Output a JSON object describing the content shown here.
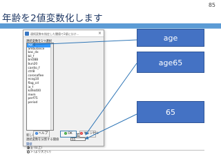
{
  "slide": {
    "number": "85",
    "title": "年齢を2値変数化します"
  },
  "dialog": {
    "title": "連続変数を指定した閾値で2値に分け...",
    "select_label": "連続変数を1つ選択",
    "variables": [
      "age",
      "ambulance",
      "bac_dx",
      "bil_f",
      "bnOBB",
      "bun20",
      "cardio_f",
      "ctrl8",
      "coronaflee",
      "ecog10",
      "flag_cd",
      "ie_f",
      "kdhk400",
      "mem",
      "perf75",
      "period"
    ],
    "selected_variable": "age",
    "new_var_label": "新しい変数名",
    "new_var_value": "age65",
    "threshold_label": "連続変数を分割する閾値",
    "threshold_value": "65",
    "direction_label": "閾値",
    "radio_options": [
      "≧ (以上)",
      "> (より大きい)"
    ],
    "radio_selected": 0,
    "buttons": {
      "help": "ヘルプ",
      "ok": "OK",
      "cancel": "キャンセル"
    }
  },
  "annotations": [
    {
      "text": "age"
    },
    {
      "text": "age65"
    },
    {
      "text": "65"
    }
  ],
  "colors": {
    "accent": "#4472c4",
    "title_text": "#1f3864",
    "title_bar": "#5b9bd5",
    "arrow": "#2e75b6",
    "selection": "#3399ff"
  }
}
